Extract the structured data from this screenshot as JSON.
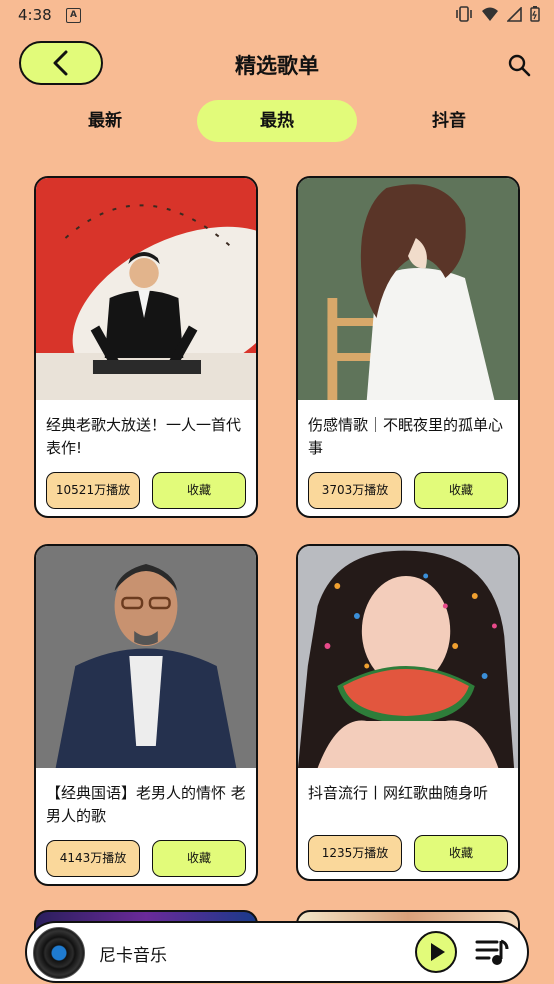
{
  "status": {
    "time": "4:38"
  },
  "header": {
    "title": "精选歌单"
  },
  "tabs": [
    {
      "label": "最新",
      "active": false
    },
    {
      "label": "最热",
      "active": true
    },
    {
      "label": "抖音",
      "active": false
    }
  ],
  "playlists": [
    {
      "title": "经典老歌大放送！一人一首代表作!",
      "plays": "10521万播放",
      "fav": "收藏"
    },
    {
      "title": "伤感情歌｜不眠夜里的孤单心事",
      "plays": "3703万播放",
      "fav": "收藏"
    },
    {
      "title": "【经典国语】老男人的情怀 老男人的歌",
      "plays": "4143万播放",
      "fav": "收藏"
    },
    {
      "title": "抖音流行丨网红歌曲随身听",
      "plays": "1235万播放",
      "fav": "收藏"
    }
  ],
  "player": {
    "song": "尼卡音乐"
  },
  "colors": {
    "background": "#F8BB93",
    "accent": "#E2FB7A",
    "plays_badge": "#FAD89B"
  }
}
